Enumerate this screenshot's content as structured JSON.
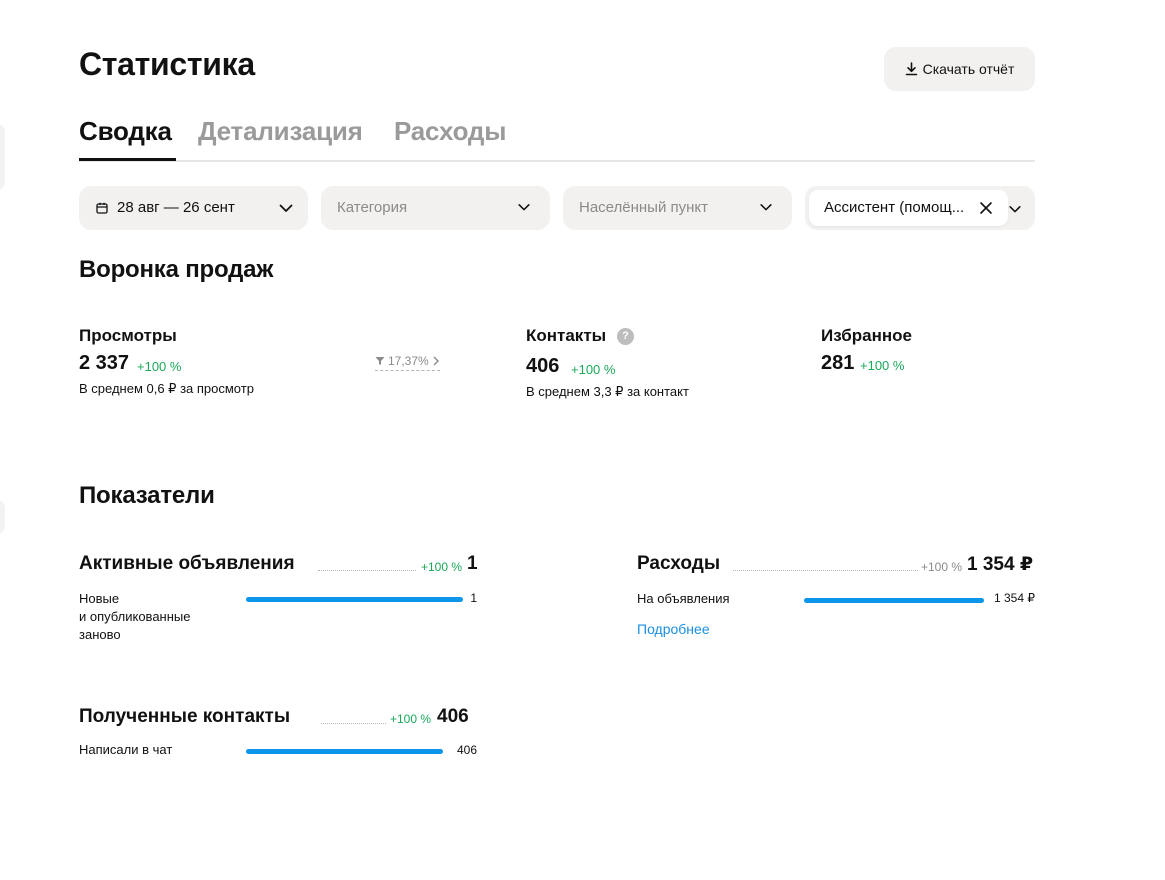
{
  "page": {
    "title": "Статистика"
  },
  "toolbar": {
    "download_label": "Скачать отчёт"
  },
  "tabs": [
    {
      "label": "Сводка",
      "active": true
    },
    {
      "label": "Детализация",
      "active": false
    },
    {
      "label": "Расходы",
      "active": false
    }
  ],
  "filters": {
    "date_range": "28 авг — 26 сент",
    "category_placeholder": "Категория",
    "location_placeholder": "Населённый пункт",
    "selected_chip": "Ассистент (помощ..."
  },
  "funnel": {
    "title": "Воронка продаж",
    "conversion": "17,37%",
    "items": [
      {
        "label": "Просмотры",
        "value": "2 337",
        "change": "+100 %",
        "sub": "В среднем 0,6 ₽ за просмотр"
      },
      {
        "label": "Контакты",
        "value": "406",
        "change": "+100 %",
        "sub": "В среднем 3,3 ₽ за контакт",
        "help_icon": "?"
      },
      {
        "label": "Избранное",
        "value": "281",
        "change": "+100 %"
      }
    ]
  },
  "indicators": {
    "title": "Показатели",
    "active_ads": {
      "title": "Активные объявления",
      "change": "+100 %",
      "total": "1",
      "rows": [
        {
          "label_lines": [
            "Новые",
            "и опубликованные",
            "заново"
          ],
          "value": "1",
          "fraction": 1.0
        }
      ]
    },
    "expenses": {
      "title": "Расходы",
      "change": "+100 %",
      "total": "1 354 ₽",
      "rows": [
        {
          "label": "На объявления",
          "value": "1 354 ₽",
          "fraction": 1.0
        }
      ],
      "more_link": "Подробнее"
    },
    "contacts": {
      "title": "Полученные контакты",
      "change": "+100 %",
      "total": "406",
      "rows": [
        {
          "label": "Написали в чат",
          "value": "406",
          "fraction": 1.0
        }
      ]
    }
  },
  "colors": {
    "positive": "#1aa85a",
    "bar": "#0b96ea",
    "link": "#1a8fe3",
    "muted": "#9a9a9a"
  }
}
